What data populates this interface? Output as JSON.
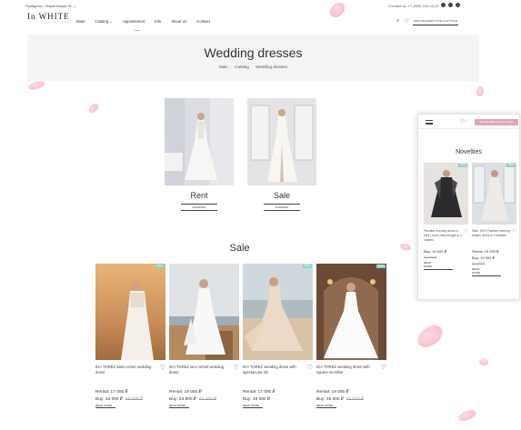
{
  "topbar": {
    "address": "Pyatigorsk, Oktyabrskaya St., |",
    "contact": "Contact us: +7 (928) 319-12-07"
  },
  "logo": {
    "main": "In WHITE",
    "sub": "collection"
  },
  "nav": [
    "Main",
    "Catalog ⌄",
    "Appointment",
    "Info",
    "About us",
    "Contact"
  ],
  "header": {
    "appointment_button": "APPOINTMENT FOR A FITTING"
  },
  "hero": {
    "title": "Wedding dresses",
    "breadcrumbs": [
      "Main",
      "Catalog",
      "Wedding dresses"
    ]
  },
  "categories": [
    {
      "label": "Rent",
      "button": "SHOWING"
    },
    {
      "label": "Sale",
      "button": "SHOWING"
    }
  ],
  "sale_section": {
    "title": "Sale"
  },
  "products": [
    {
      "name": "IDA TOREZ satin corset wedding dress",
      "badge": "SALE",
      "rent": "Rental: 17 000 ₽",
      "buy": "Buy: 32 000 ₽",
      "old": "49 000 ₽",
      "read": "READ MORE"
    },
    {
      "name": "IDA TOREZ lace corset wedding dress",
      "badge": "",
      "rent": "Rental: 19 000 ₽",
      "buy": "Buy: 33 900 ₽",
      "old": "47 000 ₽",
      "read": "READ MORE"
    },
    {
      "name": "IDA TOREZ wedding dress with spectacular slit",
      "badge": "SALE",
      "rent": "Rental: 17 000 ₽",
      "buy": "Buy: 48 000 ₽",
      "old": "",
      "read": "READ MORE"
    },
    {
      "name": "IDA TOREZ wedding dress with square neckline",
      "badge": "SALE",
      "rent": "Rental: 19 000 ₽",
      "buy": "Buy: 35 000 ₽",
      "old": "55 000 ₽",
      "read": "READ MORE"
    }
  ],
  "mobile": {
    "count": "0",
    "appointment_button": "APPOINTMENT FOR A FITTING",
    "title": "Novelties",
    "cards": [
      {
        "name": "Pavaton evening dress in mini | mod | Maxi length in 4 shades",
        "badge": "NEW",
        "rent": "Buy: 19 900 ₽",
        "buy": "",
        "old": "24 000 ₽",
        "read": "READ MORE"
      },
      {
        "name": "Sale -50% Pavaton evening bustier dress in 4 shades",
        "badge": "NEW",
        "rent": "Rental: 15 000 ₽",
        "buy": "Buy: 19 900 ₽",
        "old": "24 000 ₽",
        "read": "READ MORE"
      }
    ]
  },
  "colors": {
    "accent": "#e8a3b2",
    "badge": "#8bd4c6",
    "hero_bg": "#f4f4f6"
  }
}
